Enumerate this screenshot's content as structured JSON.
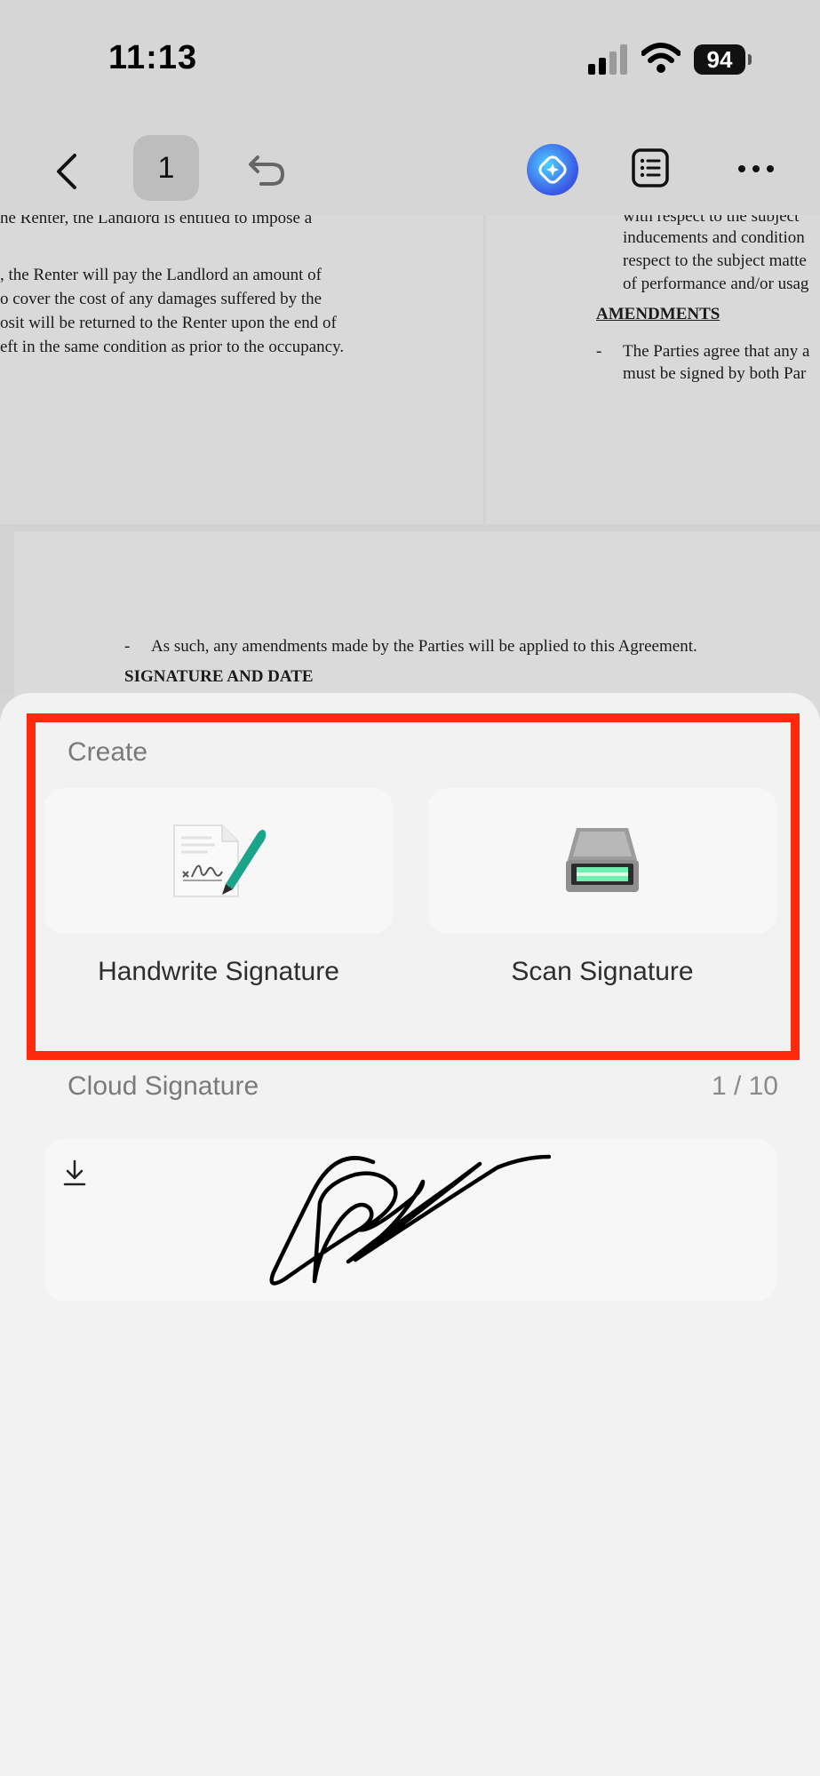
{
  "status_bar": {
    "time": "11:13",
    "battery": "94"
  },
  "toolbar": {
    "page_number": "1"
  },
  "document": {
    "left_lines": [
      "he Renter, the Landlord is entitled to impose a",
      "",
      ", the Renter will pay the Landlord an amount of",
      "o cover the cost of any damages suffered by the",
      "osit will be returned to the Renter upon the end of",
      "eft in the same condition as prior to the occupancy."
    ],
    "right_lines": [
      "with respect to the subject",
      "inducements and condition",
      "respect to the subject matte",
      "of performance and/or usag"
    ],
    "right_heading": "AMENDMENTS",
    "right_bullet_lines": [
      "The Parties agree that any a",
      "must be signed by both Par"
    ],
    "bottom_bullet": "As such, any amendments made by the Parties will be applied to this Agreement.",
    "bottom_heading": "SIGNATURE AND DATE",
    "dash": "-"
  },
  "sheet": {
    "create_title": "Create",
    "handwrite_label": "Handwrite Signature",
    "scan_label": "Scan Signature",
    "cloud_title": "Cloud Signature",
    "cloud_count": "1 / 10"
  },
  "colors": {
    "highlight": "#ff2a0d",
    "ai_button": "#3c5ce8",
    "pen_green": "#1aa58a"
  }
}
